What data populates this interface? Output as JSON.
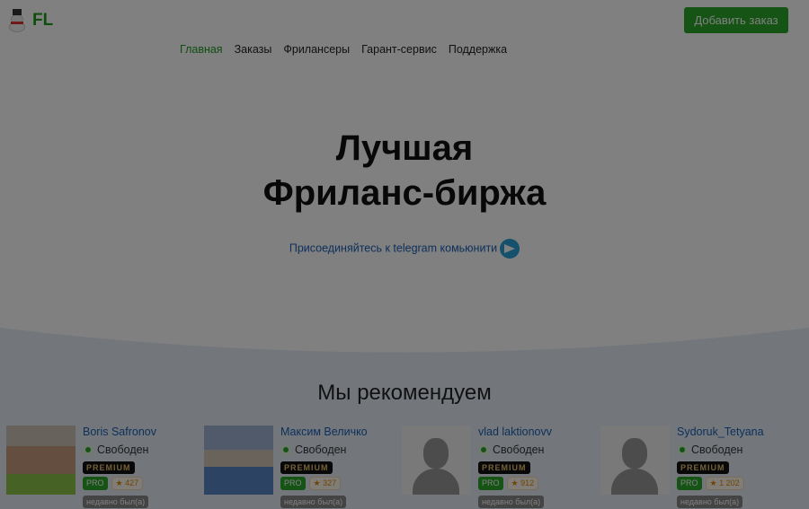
{
  "header": {
    "logo": "FL",
    "add_order": "Добавить заказ"
  },
  "nav": [
    {
      "label": "Главная",
      "active": true
    },
    {
      "label": "Заказы"
    },
    {
      "label": "Фрилансеры"
    },
    {
      "label": "Гарант-сервис"
    },
    {
      "label": "Поддержка"
    }
  ],
  "hero": {
    "line1": "Лучшая",
    "line2": "Фриланс-биржа",
    "telegram": "Присоединяйтесь к telegram комьюнити"
  },
  "recommend": {
    "title": "Мы рекомендуем",
    "cards": [
      {
        "name": "Boris Safronov",
        "status": "Свободен",
        "premium": "PREMIUM",
        "pro": "PRO",
        "rating": "★ 427",
        "seen": "недавно был(а)"
      },
      {
        "name": "Максим Величко",
        "status": "Свободен",
        "premium": "PREMIUM",
        "pro": "PRO",
        "rating": "★ 327",
        "seen": "недавно был(а)"
      },
      {
        "name": "vlad laktionovv",
        "status": "Свободен",
        "premium": "PREMIUM",
        "pro": "PRO",
        "rating": "★ 912",
        "seen": "недавно был(а)"
      },
      {
        "name": "Sydoruk_Tetyana",
        "status": "Свободен",
        "premium": "PREMIUM",
        "pro": "PRO",
        "rating": "★ 1 202",
        "seen": "недавно был(а)"
      }
    ]
  },
  "colors": {
    "brand": "#2aa82a",
    "link": "#1a5fb4"
  }
}
